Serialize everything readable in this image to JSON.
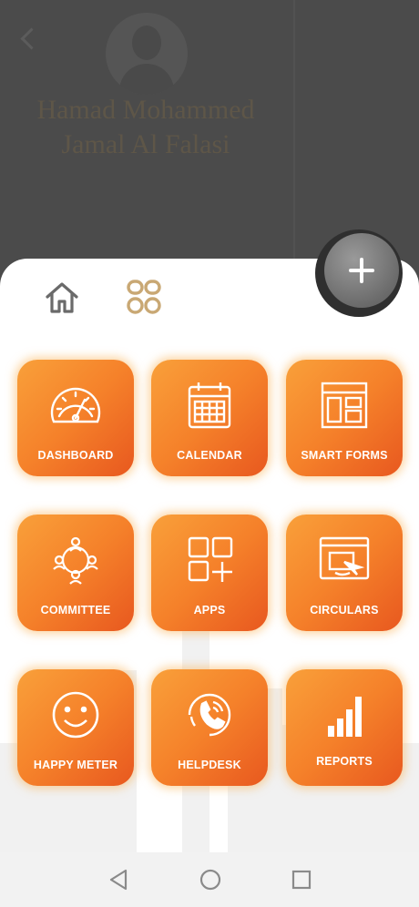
{
  "background": {
    "name_line1": "Hamad Mohammed",
    "name_line2": "Jamal Al Falasi"
  },
  "tabs": [
    {
      "icon": "home-icon",
      "active": false
    },
    {
      "icon": "apps-grid-icon",
      "active": true
    }
  ],
  "fab": {
    "icon": "plus-icon"
  },
  "tiles": [
    {
      "label": "DASHBOARD",
      "icon": "speedometer-icon"
    },
    {
      "label": "CALENDAR",
      "icon": "calendar-icon"
    },
    {
      "label": "SMART FORMS",
      "icon": "form-layout-icon"
    },
    {
      "label": "COMMITTEE",
      "icon": "people-network-icon"
    },
    {
      "label": "APPS",
      "icon": "apps-add-icon"
    },
    {
      "label": "CIRCULARS",
      "icon": "browser-cursor-icon"
    },
    {
      "label": "HAPPY METER",
      "icon": "smiley-icon"
    },
    {
      "label": "HELPDESK",
      "icon": "phone-icon"
    },
    {
      "label": "REPORTS",
      "icon": "bar-chart-icon"
    }
  ],
  "colors": {
    "tile_start": "#f9a03a",
    "tile_end": "#e8581f",
    "active_tab": "#c9a874",
    "inactive_tab": "#666666"
  },
  "system_nav": [
    "back-icon",
    "home-circle-icon",
    "recents-icon"
  ]
}
